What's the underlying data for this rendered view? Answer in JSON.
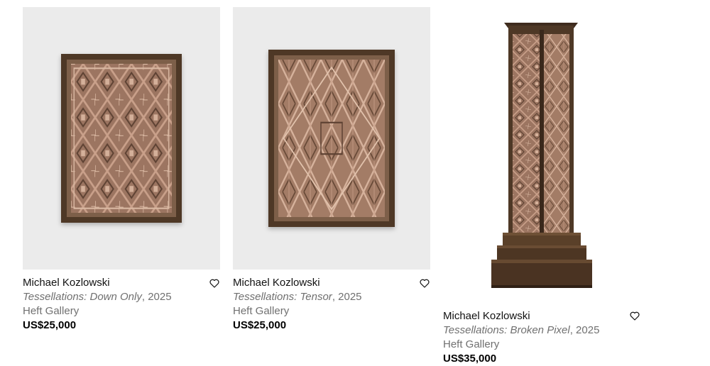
{
  "cards": [
    {
      "artist": "Michael Kozlowski",
      "title": "Tessellations: Down Only",
      "year": ", 2025",
      "gallery": "Heft Gallery",
      "price": "US$25,000",
      "favorite_icon": "heart-outline-icon"
    },
    {
      "artist": "Michael Kozlowski",
      "title": "Tessellations: Tensor",
      "year": ", 2025",
      "gallery": "Heft Gallery",
      "price": "US$25,000",
      "favorite_icon": "heart-outline-icon"
    },
    {
      "artist": "Michael Kozlowski",
      "title": "Tessellations: Broken Pixel",
      "year": ", 2025",
      "gallery": "Heft Gallery",
      "price": "US$35,000",
      "favorite_icon": "heart-outline-icon"
    }
  ],
  "colors": {
    "image_background": "#ebebeb",
    "frame_wood": "#4e3826",
    "artwork_copper": "#b98a72",
    "secondary_text": "#707070"
  }
}
